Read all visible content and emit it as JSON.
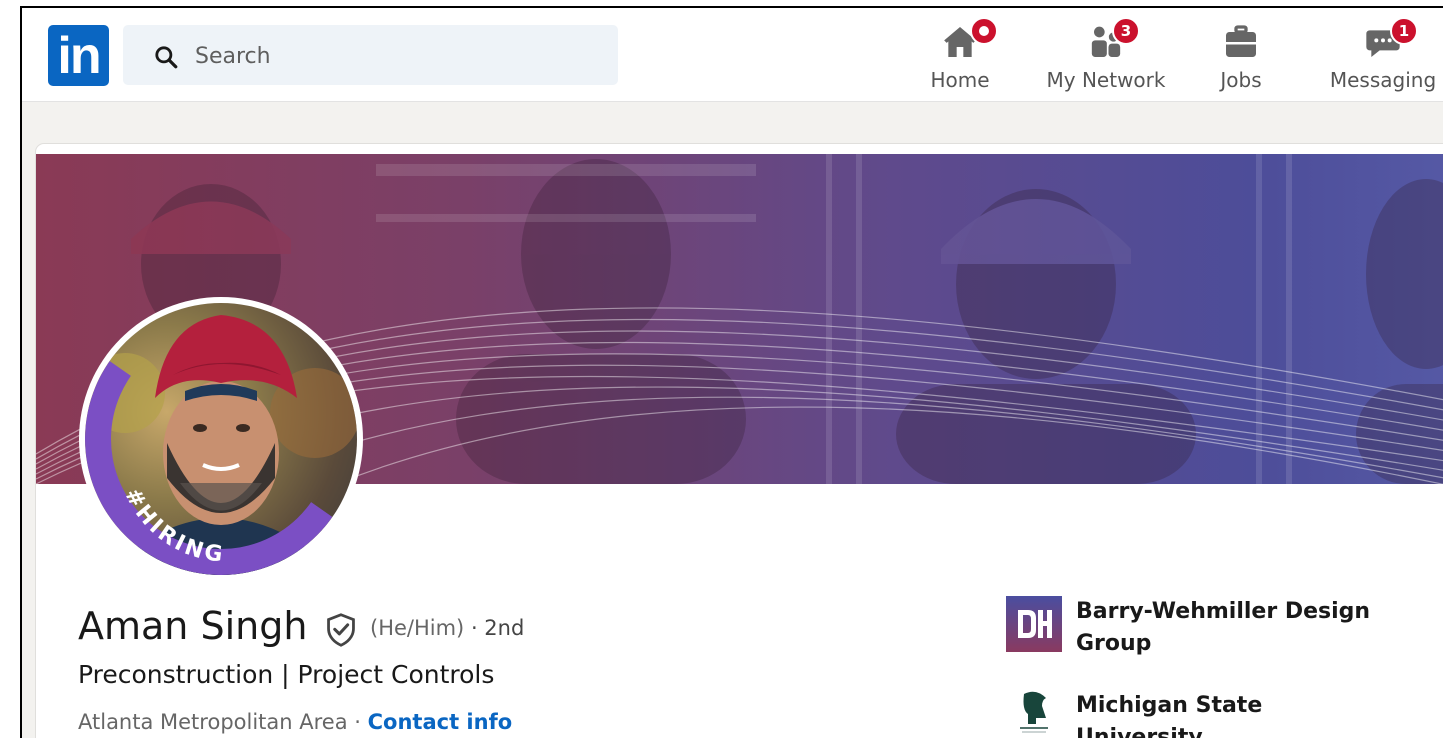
{
  "nav": {
    "logo_text": "in",
    "search_placeholder": "Search",
    "items": [
      {
        "label": "Home",
        "icon": "home-icon",
        "badge": ""
      },
      {
        "label": "My Network",
        "icon": "people-icon",
        "badge": "3"
      },
      {
        "label": "Jobs",
        "icon": "briefcase-icon",
        "badge": ""
      },
      {
        "label": "Messaging",
        "icon": "messaging-icon",
        "badge": "1"
      }
    ]
  },
  "profile": {
    "name": "Aman Singh",
    "pronouns": "(He/Him)",
    "degree": "· 2nd",
    "headline": "Preconstruction | Project Controls",
    "location": "Atlanta Metropolitan Area ·",
    "contact_label": "Contact info",
    "avatar_frame_text": "#HIRING"
  },
  "experience": [
    {
      "name": "Barry-Wehmiller Design Group",
      "logo": "bw-design-group-logo"
    },
    {
      "name": "Michigan State University",
      "logo": "spartan-helmet-logo"
    }
  ],
  "colors": {
    "brand": "#0a66c2",
    "badge": "#cb112d",
    "hiring_frame": "#7b4fc4"
  }
}
